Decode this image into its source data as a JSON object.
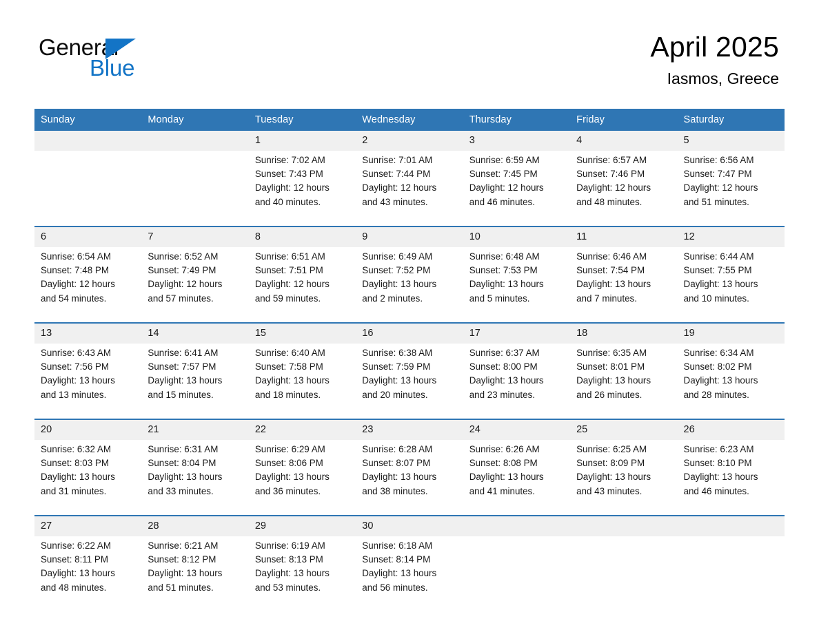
{
  "brand": {
    "name_part1": "General",
    "name_part2": "Blue",
    "accent_color": "#1374c6"
  },
  "header": {
    "title": "April 2025",
    "subtitle": "Iasmos, Greece"
  },
  "theme": {
    "header_blue": "#2f76b4",
    "date_band_gray": "#f0f0f0",
    "text_color": "#1a1a1a"
  },
  "weekday_headers": [
    "Sunday",
    "Monday",
    "Tuesday",
    "Wednesday",
    "Thursday",
    "Friday",
    "Saturday"
  ],
  "weeks": [
    {
      "dates": [
        "",
        "",
        "1",
        "2",
        "3",
        "4",
        "5"
      ],
      "cells": [
        {
          "sunrise": "",
          "sunset": "",
          "daylight_1": "",
          "daylight_2": ""
        },
        {
          "sunrise": "",
          "sunset": "",
          "daylight_1": "",
          "daylight_2": ""
        },
        {
          "sunrise": "Sunrise: 7:02 AM",
          "sunset": "Sunset: 7:43 PM",
          "daylight_1": "Daylight: 12 hours",
          "daylight_2": "and 40 minutes."
        },
        {
          "sunrise": "Sunrise: 7:01 AM",
          "sunset": "Sunset: 7:44 PM",
          "daylight_1": "Daylight: 12 hours",
          "daylight_2": "and 43 minutes."
        },
        {
          "sunrise": "Sunrise: 6:59 AM",
          "sunset": "Sunset: 7:45 PM",
          "daylight_1": "Daylight: 12 hours",
          "daylight_2": "and 46 minutes."
        },
        {
          "sunrise": "Sunrise: 6:57 AM",
          "sunset": "Sunset: 7:46 PM",
          "daylight_1": "Daylight: 12 hours",
          "daylight_2": "and 48 minutes."
        },
        {
          "sunrise": "Sunrise: 6:56 AM",
          "sunset": "Sunset: 7:47 PM",
          "daylight_1": "Daylight: 12 hours",
          "daylight_2": "and 51 minutes."
        }
      ]
    },
    {
      "dates": [
        "6",
        "7",
        "8",
        "9",
        "10",
        "11",
        "12"
      ],
      "cells": [
        {
          "sunrise": "Sunrise: 6:54 AM",
          "sunset": "Sunset: 7:48 PM",
          "daylight_1": "Daylight: 12 hours",
          "daylight_2": "and 54 minutes."
        },
        {
          "sunrise": "Sunrise: 6:52 AM",
          "sunset": "Sunset: 7:49 PM",
          "daylight_1": "Daylight: 12 hours",
          "daylight_2": "and 57 minutes."
        },
        {
          "sunrise": "Sunrise: 6:51 AM",
          "sunset": "Sunset: 7:51 PM",
          "daylight_1": "Daylight: 12 hours",
          "daylight_2": "and 59 minutes."
        },
        {
          "sunrise": "Sunrise: 6:49 AM",
          "sunset": "Sunset: 7:52 PM",
          "daylight_1": "Daylight: 13 hours",
          "daylight_2": "and 2 minutes."
        },
        {
          "sunrise": "Sunrise: 6:48 AM",
          "sunset": "Sunset: 7:53 PM",
          "daylight_1": "Daylight: 13 hours",
          "daylight_2": "and 5 minutes."
        },
        {
          "sunrise": "Sunrise: 6:46 AM",
          "sunset": "Sunset: 7:54 PM",
          "daylight_1": "Daylight: 13 hours",
          "daylight_2": "and 7 minutes."
        },
        {
          "sunrise": "Sunrise: 6:44 AM",
          "sunset": "Sunset: 7:55 PM",
          "daylight_1": "Daylight: 13 hours",
          "daylight_2": "and 10 minutes."
        }
      ]
    },
    {
      "dates": [
        "13",
        "14",
        "15",
        "16",
        "17",
        "18",
        "19"
      ],
      "cells": [
        {
          "sunrise": "Sunrise: 6:43 AM",
          "sunset": "Sunset: 7:56 PM",
          "daylight_1": "Daylight: 13 hours",
          "daylight_2": "and 13 minutes."
        },
        {
          "sunrise": "Sunrise: 6:41 AM",
          "sunset": "Sunset: 7:57 PM",
          "daylight_1": "Daylight: 13 hours",
          "daylight_2": "and 15 minutes."
        },
        {
          "sunrise": "Sunrise: 6:40 AM",
          "sunset": "Sunset: 7:58 PM",
          "daylight_1": "Daylight: 13 hours",
          "daylight_2": "and 18 minutes."
        },
        {
          "sunrise": "Sunrise: 6:38 AM",
          "sunset": "Sunset: 7:59 PM",
          "daylight_1": "Daylight: 13 hours",
          "daylight_2": "and 20 minutes."
        },
        {
          "sunrise": "Sunrise: 6:37 AM",
          "sunset": "Sunset: 8:00 PM",
          "daylight_1": "Daylight: 13 hours",
          "daylight_2": "and 23 minutes."
        },
        {
          "sunrise": "Sunrise: 6:35 AM",
          "sunset": "Sunset: 8:01 PM",
          "daylight_1": "Daylight: 13 hours",
          "daylight_2": "and 26 minutes."
        },
        {
          "sunrise": "Sunrise: 6:34 AM",
          "sunset": "Sunset: 8:02 PM",
          "daylight_1": "Daylight: 13 hours",
          "daylight_2": "and 28 minutes."
        }
      ]
    },
    {
      "dates": [
        "20",
        "21",
        "22",
        "23",
        "24",
        "25",
        "26"
      ],
      "cells": [
        {
          "sunrise": "Sunrise: 6:32 AM",
          "sunset": "Sunset: 8:03 PM",
          "daylight_1": "Daylight: 13 hours",
          "daylight_2": "and 31 minutes."
        },
        {
          "sunrise": "Sunrise: 6:31 AM",
          "sunset": "Sunset: 8:04 PM",
          "daylight_1": "Daylight: 13 hours",
          "daylight_2": "and 33 minutes."
        },
        {
          "sunrise": "Sunrise: 6:29 AM",
          "sunset": "Sunset: 8:06 PM",
          "daylight_1": "Daylight: 13 hours",
          "daylight_2": "and 36 minutes."
        },
        {
          "sunrise": "Sunrise: 6:28 AM",
          "sunset": "Sunset: 8:07 PM",
          "daylight_1": "Daylight: 13 hours",
          "daylight_2": "and 38 minutes."
        },
        {
          "sunrise": "Sunrise: 6:26 AM",
          "sunset": "Sunset: 8:08 PM",
          "daylight_1": "Daylight: 13 hours",
          "daylight_2": "and 41 minutes."
        },
        {
          "sunrise": "Sunrise: 6:25 AM",
          "sunset": "Sunset: 8:09 PM",
          "daylight_1": "Daylight: 13 hours",
          "daylight_2": "and 43 minutes."
        },
        {
          "sunrise": "Sunrise: 6:23 AM",
          "sunset": "Sunset: 8:10 PM",
          "daylight_1": "Daylight: 13 hours",
          "daylight_2": "and 46 minutes."
        }
      ]
    },
    {
      "dates": [
        "27",
        "28",
        "29",
        "30",
        "",
        "",
        ""
      ],
      "cells": [
        {
          "sunrise": "Sunrise: 6:22 AM",
          "sunset": "Sunset: 8:11 PM",
          "daylight_1": "Daylight: 13 hours",
          "daylight_2": "and 48 minutes."
        },
        {
          "sunrise": "Sunrise: 6:21 AM",
          "sunset": "Sunset: 8:12 PM",
          "daylight_1": "Daylight: 13 hours",
          "daylight_2": "and 51 minutes."
        },
        {
          "sunrise": "Sunrise: 6:19 AM",
          "sunset": "Sunset: 8:13 PM",
          "daylight_1": "Daylight: 13 hours",
          "daylight_2": "and 53 minutes."
        },
        {
          "sunrise": "Sunrise: 6:18 AM",
          "sunset": "Sunset: 8:14 PM",
          "daylight_1": "Daylight: 13 hours",
          "daylight_2": "and 56 minutes."
        },
        {
          "sunrise": "",
          "sunset": "",
          "daylight_1": "",
          "daylight_2": ""
        },
        {
          "sunrise": "",
          "sunset": "",
          "daylight_1": "",
          "daylight_2": ""
        },
        {
          "sunrise": "",
          "sunset": "",
          "daylight_1": "",
          "daylight_2": ""
        }
      ]
    }
  ]
}
